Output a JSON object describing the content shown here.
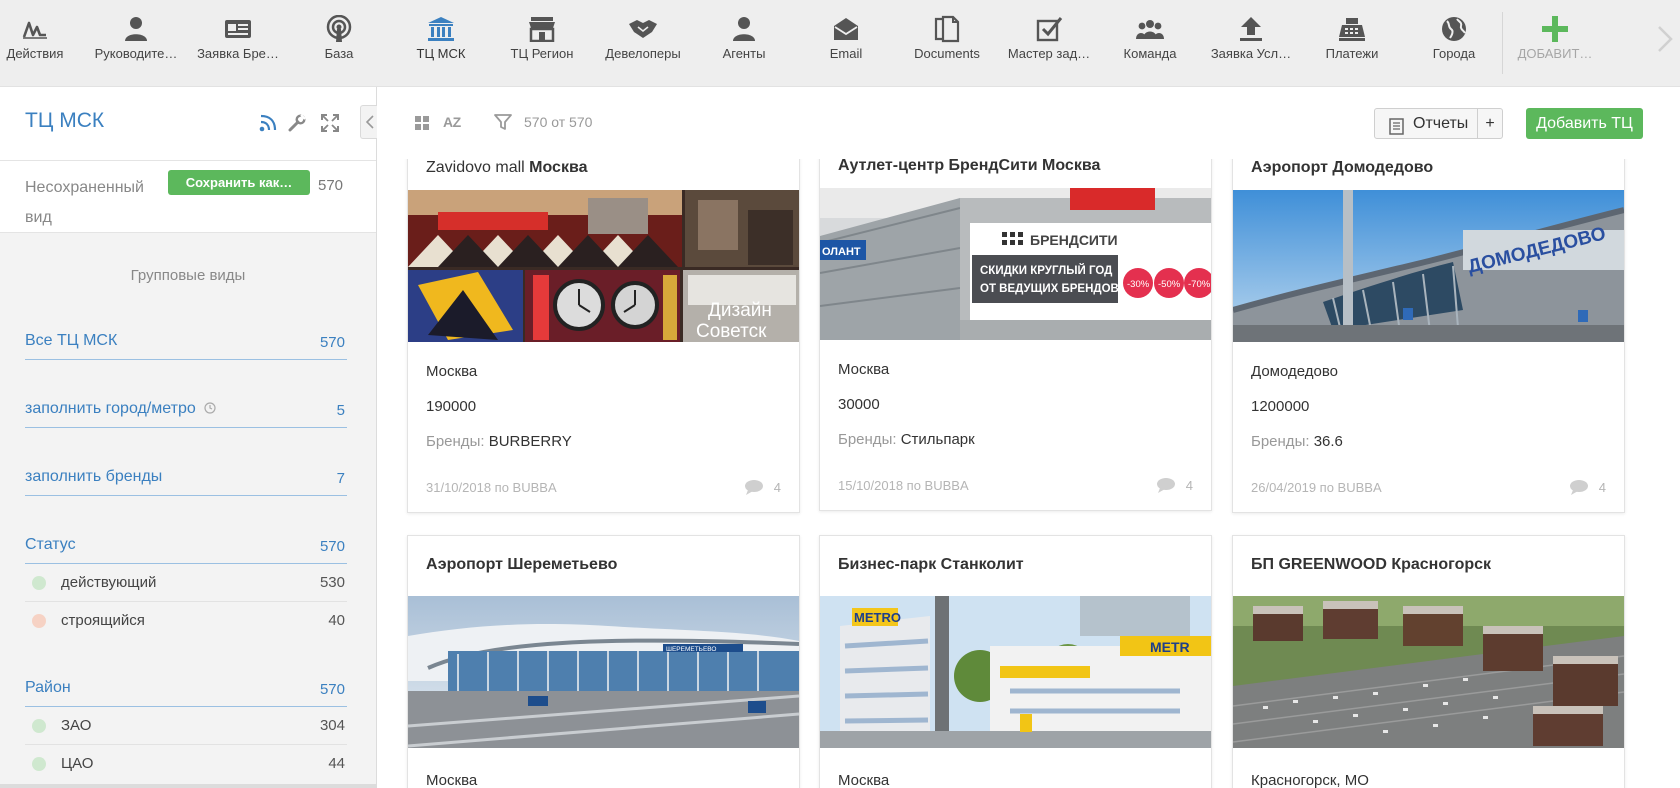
{
  "nav": {
    "items": [
      {
        "label": "Действия",
        "icon": "pulse-icon"
      },
      {
        "label": "Руководите…",
        "icon": "user-icon"
      },
      {
        "label": "Заявка Бре…",
        "icon": "id-card-icon"
      },
      {
        "label": "База",
        "icon": "broadcast-icon"
      },
      {
        "label": "ТЦ МСК",
        "icon": "institution-icon"
      },
      {
        "label": "ТЦ Регион",
        "icon": "storefront-icon"
      },
      {
        "label": "Девелоперы",
        "icon": "handshake-icon"
      },
      {
        "label": "Агенты",
        "icon": "user-icon"
      },
      {
        "label": "Email",
        "icon": "envelope-icon"
      },
      {
        "label": "Documents",
        "icon": "documents-icon"
      },
      {
        "label": "Мастер зад…",
        "icon": "checkbox-icon"
      },
      {
        "label": "Команда",
        "icon": "team-icon"
      },
      {
        "label": "Заявка Усл…",
        "icon": "upload-icon"
      },
      {
        "label": "Платежи",
        "icon": "cash-register-icon"
      },
      {
        "label": "Города",
        "icon": "globe-icon"
      },
      {
        "label": "ДОБАВИТ…",
        "icon": "plus-icon"
      }
    ],
    "accent": "#3b80c0",
    "add_color": "#5cb85c"
  },
  "sidebar": {
    "title": "ТЦ МСК",
    "unsaved_label": "Несохраненный вид",
    "save_button": "Сохранить как…",
    "total": "570",
    "group_views_title": "Групповые виды",
    "views": [
      {
        "label": "Все ТЦ МСК",
        "count": "570"
      },
      {
        "label": "заполнить город/метро",
        "count": "5"
      },
      {
        "label": "заполнить бренды",
        "count": "7"
      }
    ],
    "status": {
      "label": "Статус",
      "count": "570",
      "items": [
        {
          "label": "действующий",
          "count": "530",
          "color": "#cfe8cf"
        },
        {
          "label": "строящийся",
          "count": "40",
          "color": "#f6d2c4"
        }
      ]
    },
    "district": {
      "label": "Район",
      "count": "570",
      "items": [
        {
          "label": "ЗАО",
          "count": "304",
          "color": "#cfe8cf"
        },
        {
          "label": "ЦАО",
          "count": "44",
          "color": "#cfe8cf"
        }
      ]
    }
  },
  "toolbar": {
    "sort_label": "AZ",
    "filter_count": "570 от 570",
    "reports_label": "Отчеты",
    "plus_label": "+",
    "add_label": "Добавить ТЦ"
  },
  "cards": [
    {
      "title_plain": "Zavidovo mall",
      "title_bold": "Москва",
      "city": "Москва",
      "area": "190000",
      "brands_label": "Бренды:",
      "brands": "BURBERRY",
      "footer": "31/10/2018 по BUBBA",
      "comments": "4"
    },
    {
      "title_plain": "",
      "title_bold": "Аутлет-центр БрендСити Москва",
      "city": "Москва",
      "area": "30000",
      "brands_label": "Бренды:",
      "brands": "Стильпарк",
      "footer": "15/10/2018 по BUBBA",
      "comments": "4",
      "image_text": [
        "БРЕНДСИТИ",
        "СКИДКИ КРУГЛЫЙ ГОД",
        "ОТ ВЕДУЩИХ БРЕНДОВ",
        "-30%",
        "-50%",
        "-70%"
      ]
    },
    {
      "title_plain": "",
      "title_bold": "Аэропорт Домодедово",
      "city": "Домодедово",
      "area": "1200000",
      "brands_label": "Бренды:",
      "brands": "36.6",
      "footer": "26/04/2019 по BUBBA",
      "comments": "4",
      "image_text": [
        "ДОМОДЕДОВО"
      ]
    },
    {
      "title_plain": "",
      "title_bold": "Аэропорт Шереметьево",
      "city": "Москва"
    },
    {
      "title_plain": "",
      "title_bold": "Бизнес-парк Станколит",
      "city": "Москва",
      "image_text": [
        "METRO"
      ]
    },
    {
      "title_plain": "",
      "title_bold": "БП GREENWOOD Красногорск",
      "city": "Красногорск, МО"
    }
  ]
}
